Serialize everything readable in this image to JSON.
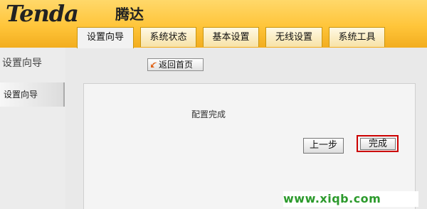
{
  "brand": {
    "logo_text": "Tenda",
    "logo_cn": "腾达"
  },
  "nav": {
    "tabs": [
      {
        "label": "设置向导",
        "active": true
      },
      {
        "label": "系统状态",
        "active": false
      },
      {
        "label": "基本设置",
        "active": false
      },
      {
        "label": "无线设置",
        "active": false
      },
      {
        "label": "系统工具",
        "active": false
      }
    ]
  },
  "page": {
    "section_title": "设置向导",
    "home_button": "返回首页"
  },
  "sidebar": {
    "items": [
      {
        "label": "设置向导"
      }
    ]
  },
  "content": {
    "message": "配置完成",
    "prev_button": "上一步",
    "finish_button": "完成"
  },
  "watermark": {
    "text": "www.xiqb.com"
  },
  "colors": {
    "header": "#ffc53a",
    "finish_highlight": "#cc0000",
    "watermark": "#2c9a2c"
  }
}
